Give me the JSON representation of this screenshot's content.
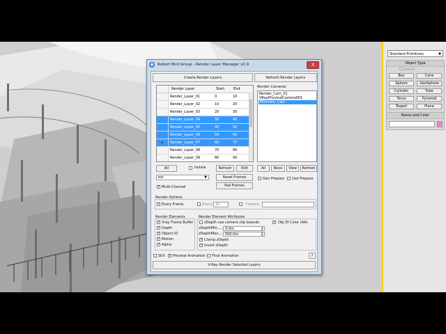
{
  "command_panel": {
    "category_dropdown": "Standard Primitives",
    "object_type": {
      "header": "Object Type",
      "autogrid": "AutoGrid",
      "buttons": [
        "Box",
        "Cone",
        "Sphere",
        "GeoSphere",
        "Cylinder",
        "Tube",
        "Torus",
        "Pyramid",
        "Teapot",
        "Plane"
      ]
    },
    "name_and_color": {
      "header": "Name and Color",
      "name_value": "",
      "swatch_color": "#e986c4"
    }
  },
  "dialog": {
    "title": "Robert Bird Group - Render Layer Manager v2.9",
    "close_label": "X",
    "create_layers": "Create Render Layers",
    "refresh_layers": "Refresh Render Layers",
    "cameras_label": "Render Cameras",
    "table": {
      "headers": [
        "Render Layer",
        "Start",
        "End"
      ],
      "rows": [
        {
          "name": "Render_Layer_01",
          "start": "0",
          "end": "10",
          "selected": false
        },
        {
          "name": "Render_Layer_02",
          "start": "10",
          "end": "20",
          "selected": false
        },
        {
          "name": "Render_Layer_03",
          "start": "20",
          "end": "30",
          "selected": false
        },
        {
          "name": "Render_Layer_04",
          "start": "30",
          "end": "40",
          "selected": true
        },
        {
          "name": "Render_Layer_05",
          "start": "40",
          "end": "50",
          "selected": true
        },
        {
          "name": "Render_Layer_06",
          "start": "50",
          "end": "60",
          "selected": true
        },
        {
          "name": "Render_Layer_07",
          "start": "60",
          "end": "70",
          "selected": true
        },
        {
          "name": "Render_Layer_08",
          "start": "70",
          "end": "80",
          "selected": false
        },
        {
          "name": "Render_Layer_09",
          "start": "80",
          "end": "90",
          "selected": false
        }
      ]
    },
    "cameras": [
      {
        "name": "Render_Cam_01",
        "selected": false
      },
      {
        "name": "VRayPhysicalCamera001",
        "selected": false
      },
      {
        "name": "Alternate_Cam",
        "selected": true
      }
    ],
    "layer_buttons": {
      "all": "All",
      "isolate": "Isolate",
      "refresh": "Refresh",
      "edit": "Edit",
      "reset_frames": "Reset Frames",
      "pad_frames": "Pad Frames"
    },
    "format_value": "exr",
    "multichannel": "Multi-Channel",
    "camera_buttons": {
      "all": "All",
      "none": "None",
      "view": "View",
      "refresh": "Refresh"
    },
    "gen_prepass": "Gen Prepass",
    "use_prepass": "Use Prepass",
    "render_options": {
      "title": "Render Options",
      "every_frame": "Every Frame",
      "every": "Every:",
      "every_value": "10",
      "frames": "Frames:",
      "frames_value": ""
    },
    "render_elements": {
      "title": "Render Elements",
      "items": [
        "Vray Frame Buffer",
        "Depth",
        "Object ID",
        "Motion",
        "Alpha"
      ]
    },
    "attributes": {
      "title": "Render Element Attributes",
      "zdepth_clip": "zDepth use camera clip bounds",
      "min_label": "zDepthMin......",
      "min_value": "0.0m",
      "max_label": "zDepthMax......",
      "max_value": "500.0m",
      "clamp": "Clamp zDepth",
      "invert": "Invert zDepth",
      "objid_color": "Obj ID Color (AA)"
    },
    "still": "Still",
    "preview_animation": "Preview Animation",
    "final_animation": "Final Animation",
    "help": "?",
    "render_button": "V-Ray Render Selected Layers"
  }
}
